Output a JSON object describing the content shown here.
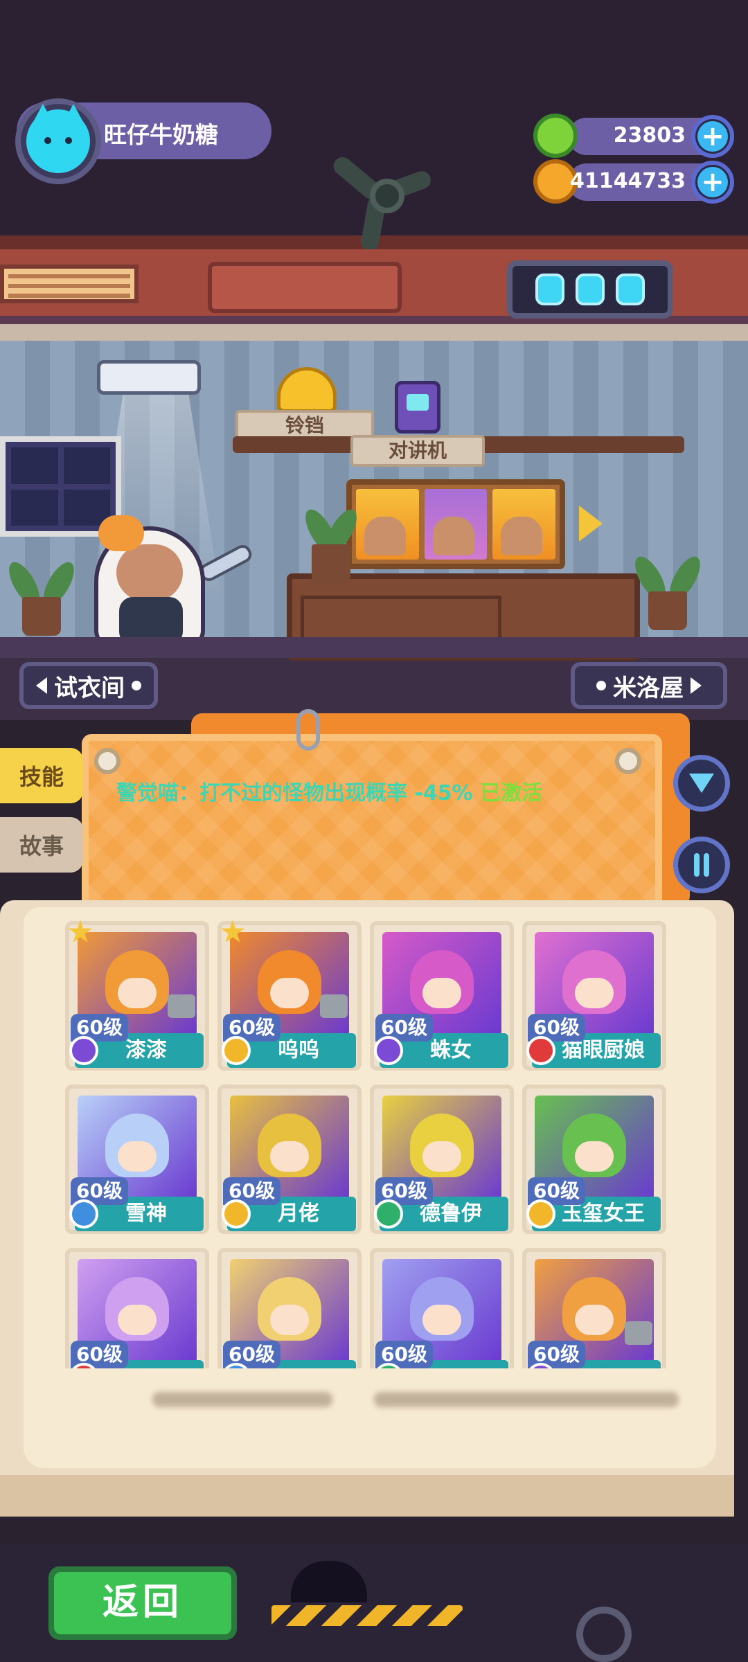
{
  "player": {
    "name": "旺仔牛奶糖",
    "avatar_icon": "cat-face-icon"
  },
  "currencies": [
    {
      "name": "green-gem",
      "value": "23803",
      "color": "#7ed23a"
    },
    {
      "name": "gold-coin",
      "value": "41144733",
      "color": "#f4a72b"
    }
  ],
  "room": {
    "bell_label": "铃铛",
    "walkie_label": "对讲机",
    "left_nav_label": "试衣间",
    "right_nav_label": "米洛屋"
  },
  "tabs": [
    {
      "label": "技能",
      "active": true
    },
    {
      "label": "故事",
      "active": false
    }
  ],
  "skill": {
    "text": "警觉喵：打不过的怪物出现概率 -45%",
    "status": "已激活"
  },
  "characters": [
    {
      "level": "60级",
      "name": "漆漆",
      "badge": "#7b4bd6",
      "art": "#f09a38",
      "star": true,
      "shirt": true
    },
    {
      "level": "60级",
      "name": "呜呜",
      "badge": "#f2b62a",
      "art": "#f08a2c",
      "star": true,
      "shirt": true
    },
    {
      "level": "60级",
      "name": "蛛女",
      "badge": "#7b4bd6",
      "art": "#d65ac8",
      "star": false,
      "shirt": false
    },
    {
      "level": "60级",
      "name": "猫眼厨娘",
      "badge": "#e03a3a",
      "art": "#e070d0",
      "star": false,
      "shirt": false
    },
    {
      "level": "60级",
      "name": "雪神",
      "badge": "#3f8ee0",
      "art": "#b8d0f8",
      "star": false,
      "shirt": false
    },
    {
      "level": "60级",
      "name": "月佬",
      "badge": "#f2b62a",
      "art": "#e8c040",
      "star": false,
      "shirt": false
    },
    {
      "level": "60级",
      "name": "德鲁伊",
      "badge": "#2fb06a",
      "art": "#e8d040",
      "star": false,
      "shirt": false
    },
    {
      "level": "60级",
      "name": "玉玺女王",
      "badge": "#f2b62a",
      "art": "#68c050",
      "star": false,
      "shirt": false
    },
    {
      "level": "60级",
      "name": "",
      "badge": "#e03a3a",
      "art": "#d0a0f0",
      "star": false,
      "shirt": false
    },
    {
      "level": "60级",
      "name": "",
      "badge": "#3f8ee0",
      "art": "#f0d070",
      "star": false,
      "shirt": false
    },
    {
      "level": "60级",
      "name": "",
      "badge": "#2fb06a",
      "art": "#a0a0f0",
      "star": false,
      "shirt": false
    },
    {
      "level": "60级",
      "name": "",
      "badge": "#7b4bd6",
      "art": "#f0a040",
      "star": false,
      "shirt": true
    }
  ],
  "bottom": {
    "back_label": "返回"
  }
}
